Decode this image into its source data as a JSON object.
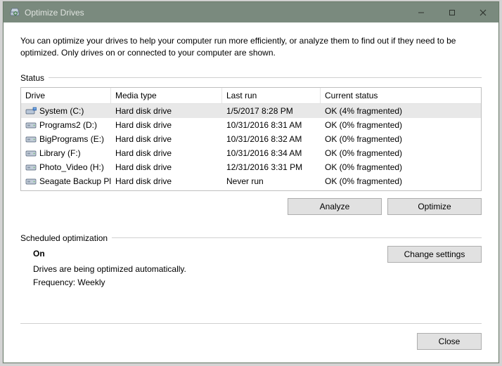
{
  "window": {
    "title": "Optimize Drives"
  },
  "intro": "You can optimize your drives to help your computer run more efficiently, or analyze them to find out if they need to be optimized. Only drives on or connected to your computer are shown.",
  "status_label": "Status",
  "columns": {
    "drive": "Drive",
    "media": "Media type",
    "last": "Last run",
    "status": "Current status"
  },
  "drives": [
    {
      "name": "System (C:)",
      "media": "Hard disk drive",
      "last": "1/5/2017 8:28 PM",
      "status": "OK (4% fragmented)",
      "selected": true,
      "icon": "system"
    },
    {
      "name": "Programs2 (D:)",
      "media": "Hard disk drive",
      "last": "10/31/2016 8:31 AM",
      "status": "OK (0% fragmented)",
      "selected": false,
      "icon": "hdd"
    },
    {
      "name": "BigPrograms (E:)",
      "media": "Hard disk drive",
      "last": "10/31/2016 8:32 AM",
      "status": "OK (0% fragmented)",
      "selected": false,
      "icon": "hdd"
    },
    {
      "name": "Library (F:)",
      "media": "Hard disk drive",
      "last": "10/31/2016 8:34 AM",
      "status": "OK (0% fragmented)",
      "selected": false,
      "icon": "hdd"
    },
    {
      "name": "Photo_Video (H:)",
      "media": "Hard disk drive",
      "last": "12/31/2016 3:31 PM",
      "status": "OK (0% fragmented)",
      "selected": false,
      "icon": "hdd"
    },
    {
      "name": "Seagate Backup Pl...",
      "media": "Hard disk drive",
      "last": "Never run",
      "status": "OK (0% fragmented)",
      "selected": false,
      "icon": "hdd"
    }
  ],
  "buttons": {
    "analyze": "Analyze",
    "optimize": "Optimize",
    "change_settings": "Change settings",
    "close": "Close"
  },
  "scheduled": {
    "label": "Scheduled optimization",
    "state": "On",
    "desc": "Drives are being optimized automatically.",
    "freq": "Frequency: Weekly"
  }
}
